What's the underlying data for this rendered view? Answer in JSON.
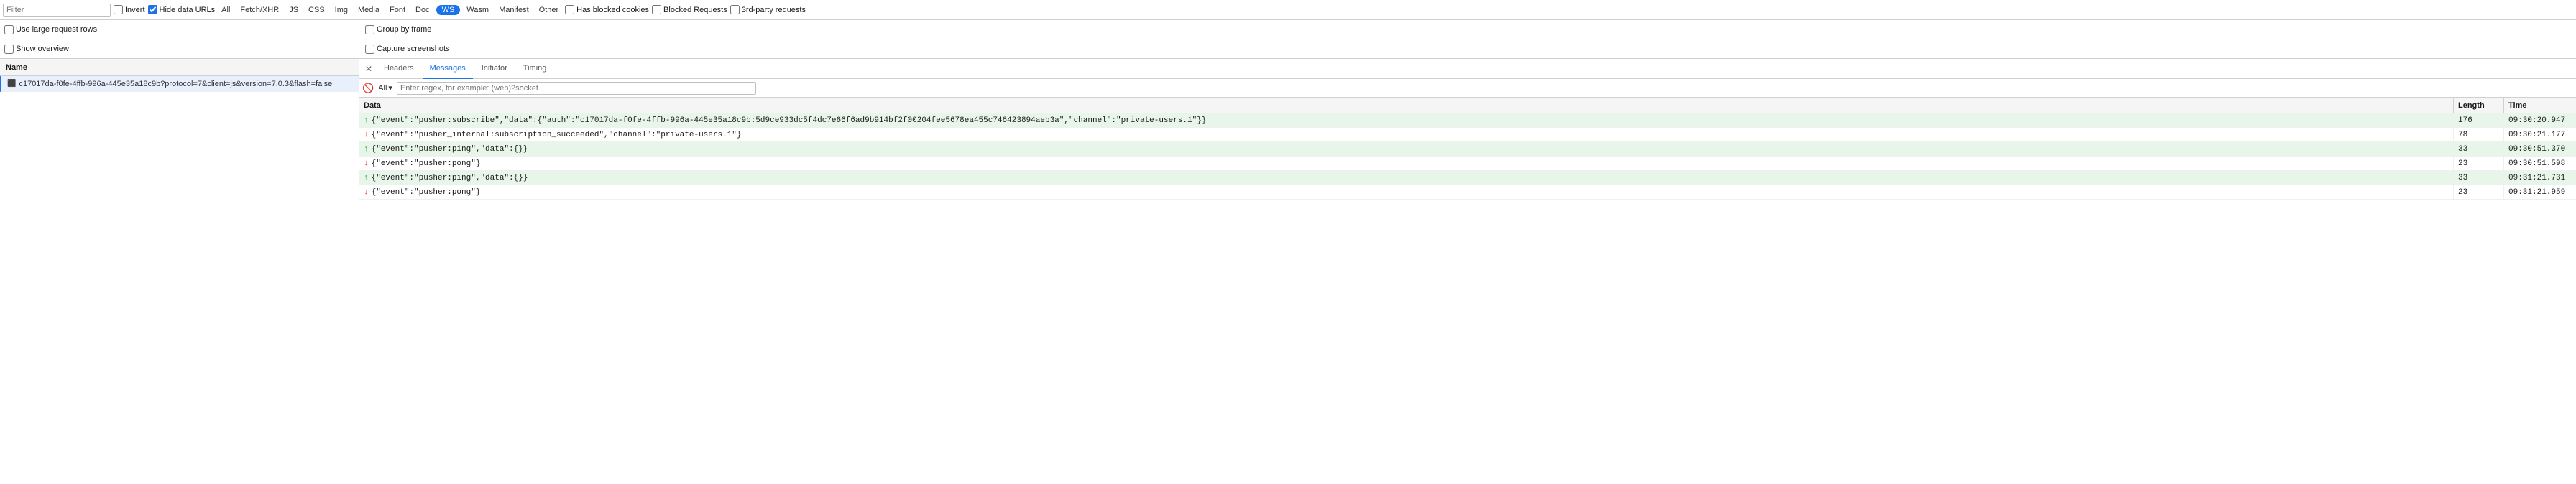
{
  "toolbar": {
    "filter_placeholder": "Filter",
    "invert_label": "Invert",
    "hide_data_urls_label": "Hide data URLs",
    "all_label": "All",
    "fetch_xhr_label": "Fetch/XHR",
    "js_label": "JS",
    "css_label": "CSS",
    "img_label": "Img",
    "media_label": "Media",
    "font_label": "Font",
    "doc_label": "Doc",
    "ws_label": "WS",
    "wasm_label": "Wasm",
    "manifest_label": "Manifest",
    "other_label": "Other",
    "has_blocked_cookies_label": "Has blocked cookies",
    "blocked_requests_label": "Blocked Requests",
    "third_party_label": "3rd-party requests",
    "use_large_rows_label": "Use large request rows",
    "show_overview_label": "Show overview",
    "group_by_frame_label": "Group by frame",
    "capture_screenshots_label": "Capture screenshots"
  },
  "name_header": "Name",
  "requests": [
    {
      "id": "req-1",
      "name": "c17017da-f0fe-4ffb-996a-445e35a18c9b?protocol=7&client=js&version=7.0.3&flash=false",
      "selected": true
    }
  ],
  "tabs": [
    {
      "id": "headers",
      "label": "Headers"
    },
    {
      "id": "messages",
      "label": "Messages",
      "active": true
    },
    {
      "id": "initiator",
      "label": "Initiator"
    },
    {
      "id": "timing",
      "label": "Timing"
    }
  ],
  "messages_filter": {
    "all_label": "All",
    "regex_placeholder": "Enter regex, for example: (web)?socket"
  },
  "messages_table": {
    "col_data": "Data",
    "col_length": "Length",
    "col_time": "Time",
    "rows": [
      {
        "direction": "send",
        "data": "{\"event\":\"pusher:subscribe\",\"data\":{\"auth\":\"c17017da-f0fe-4ffb-996a-445e35a18c9b:5d9ce933dc5f4dc7e66f6ad9b914bf2f00204fee5678ea455c746423894aeb3a\",\"channel\":\"private-users.1\"}}",
        "length": "176",
        "time": "09:30:20.947"
      },
      {
        "direction": "receive",
        "data": "{\"event\":\"pusher_internal:subscription_succeeded\",\"channel\":\"private-users.1\"}",
        "length": "78",
        "time": "09:30:21.177"
      },
      {
        "direction": "send",
        "data": "{\"event\":\"pusher:ping\",\"data\":{}}",
        "length": "33",
        "time": "09:30:51.370"
      },
      {
        "direction": "receive",
        "data": "{\"event\":\"pusher:pong\"}",
        "length": "23",
        "time": "09:30:51.598"
      },
      {
        "direction": "send",
        "data": "{\"event\":\"pusher:ping\",\"data\":{}}",
        "length": "33",
        "time": "09:31:21.731"
      },
      {
        "direction": "receive",
        "data": "{\"event\":\"pusher:pong\"}",
        "length": "23",
        "time": "09:31:21.959"
      }
    ]
  }
}
